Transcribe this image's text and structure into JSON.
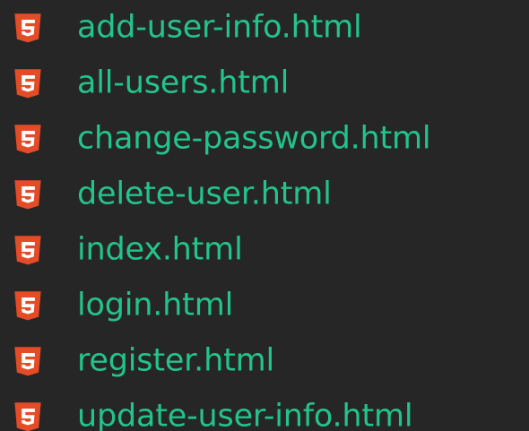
{
  "colors": {
    "background": "#262626",
    "file_name": "#23c48b",
    "html_icon_shield": "#e34c26",
    "html_icon_glyph": "#ffffff"
  },
  "files": [
    {
      "name": "add-user-info.html",
      "icon": "html5-icon"
    },
    {
      "name": "all-users.html",
      "icon": "html5-icon"
    },
    {
      "name": "change-password.html",
      "icon": "html5-icon"
    },
    {
      "name": "delete-user.html",
      "icon": "html5-icon"
    },
    {
      "name": "index.html",
      "icon": "html5-icon"
    },
    {
      "name": "login.html",
      "icon": "html5-icon"
    },
    {
      "name": "register.html",
      "icon": "html5-icon"
    },
    {
      "name": "update-user-info.html",
      "icon": "html5-icon"
    }
  ]
}
